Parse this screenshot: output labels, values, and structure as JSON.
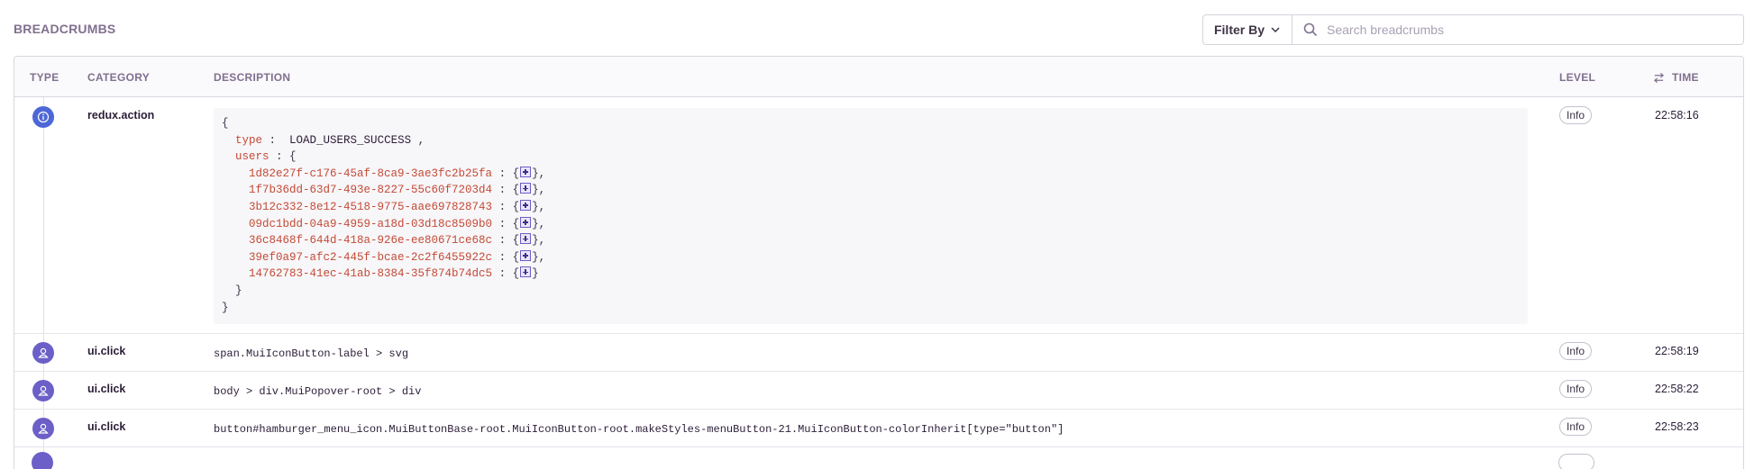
{
  "section": {
    "title": "BREADCRUMBS"
  },
  "filter": {
    "label": "Filter By",
    "icon": "chevron-down-icon"
  },
  "search": {
    "placeholder": "Search breadcrumbs",
    "icon": "search-icon"
  },
  "columns": {
    "type": "TYPE",
    "category": "CATEGORY",
    "description": "DESCRIPTION",
    "level": "LEVEL",
    "time": "TIME",
    "time_icon": "sort-arrows-icon"
  },
  "colors": {
    "info_icon": "#4e67d6",
    "user_icon": "#6c5fc7",
    "key": "#c44b36",
    "accent": "#6c5fc7"
  },
  "rows": [
    {
      "type_icon": "info-icon",
      "category": "redux.action",
      "level": "Info",
      "time": "22:58:16",
      "payload": {
        "open": "{",
        "type_key": "type",
        "type_value": "LOAD_USERS_SUCCESS",
        "users_key": "users",
        "users_open": "{",
        "user_ids": [
          "1d82e27f-c176-45af-8ca9-3ae3fc2b25fa",
          "1f7b36dd-63d7-493e-8227-55c60f7203d4",
          "3b12c332-8e12-4518-9775-aae697828743",
          "09dc1bdd-04a9-4959-a18d-03d18c8509b0",
          "36c8468f-644d-418a-926e-ee80671ce68c",
          "39ef0a97-afc2-445f-bcae-2c2f6455922c",
          "14762783-41ec-41ab-8384-35f874b74dc5"
        ],
        "users_close": "}",
        "close": "}"
      }
    },
    {
      "type_icon": "user-icon",
      "category": "ui.click",
      "description": "span.MuiIconButton-label > svg",
      "level": "Info",
      "time": "22:58:19"
    },
    {
      "type_icon": "user-icon",
      "category": "ui.click",
      "description": "body > div.MuiPopover-root > div",
      "level": "Info",
      "time": "22:58:22"
    },
    {
      "type_icon": "user-icon",
      "category": "ui.click",
      "description": "button#hamburger_menu_icon.MuiButtonBase-root.MuiIconButton-root.makeStyles-menuButton-21.MuiIconButton-colorInherit[type=\"button\"]",
      "level": "Info",
      "time": "22:58:23"
    }
  ]
}
